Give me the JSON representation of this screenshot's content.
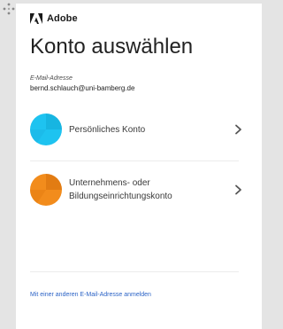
{
  "brand": {
    "name": "Adobe",
    "logo_icon": "adobe-logo-icon",
    "logo_color": "#1a1a1a"
  },
  "page": {
    "title": "Konto auswählen"
  },
  "email": {
    "label": "E-Mail-Adresse",
    "value": "bernd.schlauch@uni-bamberg.de"
  },
  "accounts": [
    {
      "label_line1": "Persönliches Konto",
      "label_line2": "",
      "avatar_color": "#1ec3f0",
      "avatar_shade": "#13a9d6",
      "icon": "personal-account-avatar-icon"
    },
    {
      "label_line1": "Unternehmens- oder",
      "label_line2": "Bildungseinrichtungskonto",
      "avatar_color": "#f28c1c",
      "avatar_shade": "#d6700c",
      "icon": "business-account-avatar-icon"
    }
  ],
  "footer": {
    "link_label": "Mit einer anderen E-Mail-Adresse anmelden",
    "link_color": "#2b63c6"
  },
  "icons": {
    "drag": "drag-handle-icon",
    "chevron": "chevron-right-icon"
  }
}
